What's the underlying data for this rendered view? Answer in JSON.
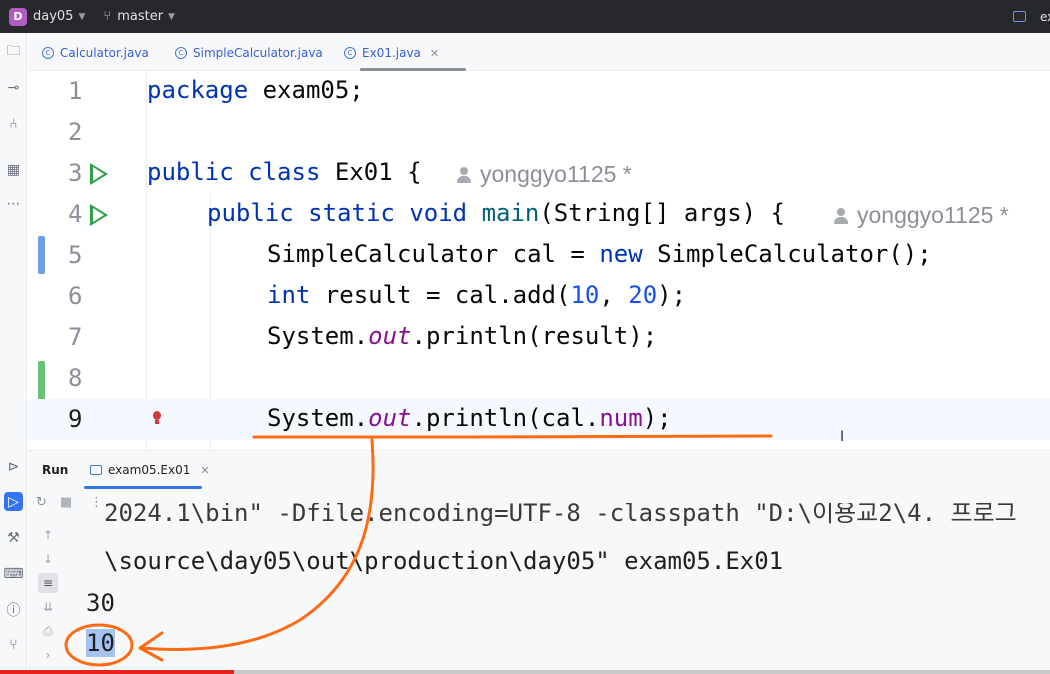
{
  "titlebar": {
    "project_badge": "D",
    "project_name": "day05",
    "branch": "master",
    "right_text": "ex"
  },
  "tabs": [
    {
      "label": "Calculator.java",
      "active": false
    },
    {
      "label": "SimpleCalculator.java",
      "active": false
    },
    {
      "label": "Ex01.java",
      "active": true
    }
  ],
  "editor": {
    "lines": [
      {
        "n": "1"
      },
      {
        "n": "2"
      },
      {
        "n": "3"
      },
      {
        "n": "4"
      },
      {
        "n": "5"
      },
      {
        "n": "6"
      },
      {
        "n": "7"
      },
      {
        "n": "8"
      },
      {
        "n": "9"
      }
    ],
    "line1": {
      "kw": "package",
      "rest": " exam05;"
    },
    "line3": {
      "kw1": "public",
      "kw2": "class",
      "rest": " Ex01 {",
      "author": "yonggyo1125 *"
    },
    "line4": {
      "kw1": "public",
      "kw2": "static",
      "kw3": "void",
      "name": "main",
      "rest": "(String[] args) {",
      "author": "yonggyo1125 *"
    },
    "line5": {
      "a": "SimpleCalculator cal = ",
      "kw": "new",
      "b": " SimpleCalculator();"
    },
    "line6": {
      "kw": "int",
      "a": " result = cal.add(",
      "n1": "10",
      "sep": ", ",
      "n2": "20",
      "b": ");"
    },
    "line7": {
      "a": "System.",
      "it": "out",
      "b": ".println(result);"
    },
    "line9": {
      "a": "System.",
      "it": "out",
      "b": ".println(cal.",
      "fld": "num",
      "c": ");"
    }
  },
  "run": {
    "title": "Run",
    "tab_label": "exam05.Ex01",
    "console_clipped": "2024.1\\bin\" -Dfile.encoding=UTF-8 -classpath \"D:\\이용교2\\4. 프로그",
    "console_path": "\\source\\day05\\out\\production\\day05\" exam05.Ex01",
    "output1": "30",
    "output2": "10"
  },
  "colors": {
    "accent": "#3574f0",
    "run_green": "#2e9f4a",
    "annotation_orange": "#ff6a13",
    "keyword": "#0033b3"
  }
}
